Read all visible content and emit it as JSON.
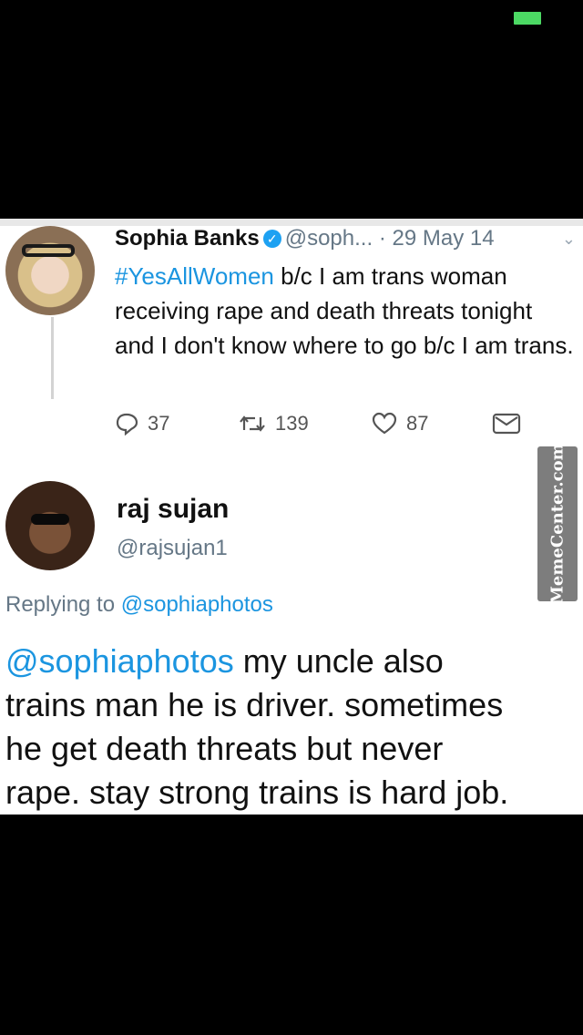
{
  "status_bar": {
    "battery_color": "#4cd964"
  },
  "original_tweet": {
    "author_name": "Sophia Banks",
    "handle": "@soph...",
    "separator": "·",
    "date": "29 May 14",
    "hashtag": "#YesAllWomen",
    "text_rest": " b/c I am trans woman receiving rape and death threats tonight and I don't know where to go b/c I am trans.",
    "actions": {
      "reply_count": "37",
      "retweet_count": "139",
      "like_count": "87"
    }
  },
  "reply": {
    "author_name": "raj sujan",
    "handle": "@rajsujan1",
    "replying_label": "Replying to ",
    "replying_to": "@sophiaphotos",
    "mention": "@sophiaphotos",
    "lines": [
      " my uncle also",
      "trains man he is driver. sometimes",
      "he get death threats but never",
      "rape. stay strong trains is hard job."
    ]
  },
  "watermark": {
    "text": "MemeCenter.com"
  },
  "colors": {
    "link": "#1b95e0",
    "verified": "#1da1f2",
    "muted": "#657786"
  }
}
